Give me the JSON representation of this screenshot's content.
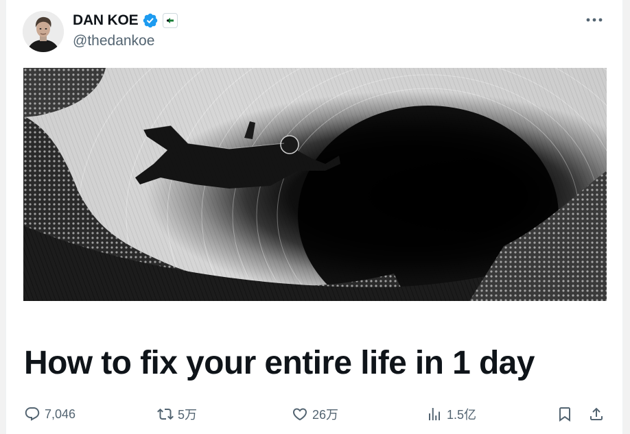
{
  "author": {
    "display_name": "DAN KOE",
    "handle": "@thedankoe",
    "verified_icon": "verified-badge-icon",
    "affiliate_icon": "affiliate-logo-icon"
  },
  "header": {
    "more_icon": "more-horizontal-icon"
  },
  "article": {
    "title": "How to fix your entire life in 1 day",
    "cover_image": "black-and-white engraving of astronaut falling into a vortex"
  },
  "actions": {
    "replies": "7,046",
    "reposts": "5万",
    "likes": "26万",
    "views": "1.5亿"
  },
  "colors": {
    "text_primary": "#0f1419",
    "text_secondary": "#536471",
    "verified_blue": "#1d9bf0"
  }
}
